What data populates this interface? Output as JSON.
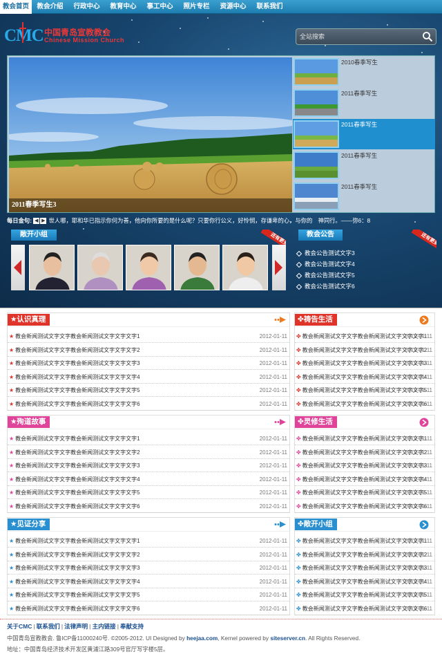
{
  "nav": [
    "教会首页",
    "教会介绍",
    "行政中心",
    "教育中心",
    "事工中心",
    "照片专栏",
    "资源中心",
    "联系我们"
  ],
  "logo": {
    "mark": "CMC",
    "cn": "中国青岛宣教教会",
    "en": "Chinese Mission Church"
  },
  "search": {
    "placeholder": "全站搜索"
  },
  "slider": {
    "caption": "2011春季写生3",
    "thumbs": [
      "2010春季写生",
      "2011春季写生",
      "2011春季写生",
      "2011春季写生",
      "2011春季写生"
    ],
    "active_index": 2
  },
  "verse": {
    "label": "每日金句:",
    "text": "世人哪，耶和华已指示你何为善，他向你所要的是什么呢？只要你行公义，好怜悯，存谦卑的心，与你的　神同行。——弥6：8"
  },
  "group": {
    "title": "敞开小组",
    "more": "还有更多"
  },
  "notice": {
    "title": "教会公告",
    "more": "还有更多",
    "items": [
      "教会公告测试文字3",
      "教会公告测试文字4",
      "教会公告测试文字5",
      "教会公告测试文字6"
    ]
  },
  "colors": {
    "red": "#e0342a",
    "orange": "#ee7a20",
    "pink": "#e0449a",
    "blue": "#2a8fd0"
  },
  "sections": [
    {
      "title": "认识真理",
      "rows": [
        "教会新闻测试文字文字教会新闻测试文字文字文字1",
        "教会新闻测试文字文字教会新闻测试文字文字文字2",
        "教会新闻测试文字文字教会新闻测试文字文字文字3",
        "教会新闻测试文字文字教会新闻测试文字文字文字4",
        "教会新闻测试文字文字教会新闻测试文字文字文字5",
        "教会新闻测试文字文字教会新闻测试文字文字文字6"
      ]
    },
    {
      "title": "祷告生活",
      "rows": [
        "教会新闻测试文字文字教会新闻测试文字文字文字1",
        "教会新闻测试文字文字教会新闻测试文字文字文字2",
        "教会新闻测试文字文字教会新闻测试文字文字文字3",
        "教会新闻测试文字文字教会新闻测试文字文字文字4",
        "教会新闻测试文字文字教会新闻测试文字文字文字5",
        "教会新闻测试文字文字教会新闻测试文字文字文字6"
      ]
    },
    {
      "title": "殉道故事",
      "rows": [
        "教会新闻测试文字文字教会新闻测试文字文字文字1",
        "教会新闻测试文字文字教会新闻测试文字文字文字2",
        "教会新闻测试文字文字教会新闻测试文字文字文字3",
        "教会新闻测试文字文字教会新闻测试文字文字文字4",
        "教会新闻测试文字文字教会新闻测试文字文字文字5",
        "教会新闻测试文字文字教会新闻测试文字文字文字6"
      ]
    },
    {
      "title": "灵修生活",
      "rows": [
        "教会新闻测试文字文字教会新闻测试文字文字文字1",
        "教会新闻测试文字文字教会新闻测试文字文字文字2",
        "教会新闻测试文字文字教会新闻测试文字文字文字3",
        "教会新闻测试文字文字教会新闻测试文字文字文字4",
        "教会新闻测试文字文字教会新闻测试文字文字文字5",
        "教会新闻测试文字文字教会新闻测试文字文字文字6"
      ]
    },
    {
      "title": "见证分享",
      "rows": [
        "教会新闻测试文字文字教会新闻测试文字文字文字1",
        "教会新闻测试文字文字教会新闻测试文字文字文字2",
        "教会新闻测试文字文字教会新闻测试文字文字文字3",
        "教会新闻测试文字文字教会新闻测试文字文字文字4",
        "教会新闻测试文字文字教会新闻测试文字文字文字5",
        "教会新闻测试文字文字教会新闻测试文字文字文字6"
      ]
    },
    {
      "title": "敞开小组",
      "rows": [
        "教会新闻测试文字文字教会新闻测试文字文字文字1",
        "教会新闻测试文字文字教会新闻测试文字文字文字2",
        "教会新闻测试文字文字教会新闻测试文字文字文字3",
        "教会新闻测试文字文字教会新闻测试文字文字文字4",
        "教会新闻测试文字文字教会新闻测试文字文字文字5",
        "教会新闻测试文字文字教会新闻测试文字文字文字6"
      ]
    }
  ],
  "date": "2012-01-11",
  "footer": {
    "links": [
      "关于CMC",
      "联系我们",
      "法律声明",
      "主内链接",
      "奉献支持"
    ],
    "copyright_pre": "中国青岛宣教教会. 鲁ICP备11000240号. ©2005-2012. UI Designed by ",
    "designer": "heejaa.com",
    "mid": ", Kernel powered by ",
    "kernel": "siteserver.cn",
    "post": ". All Rights Reserved.",
    "address": "地址：中国青岛经济技术开发区黄浦江路309号官厅写字楼5层。"
  }
}
